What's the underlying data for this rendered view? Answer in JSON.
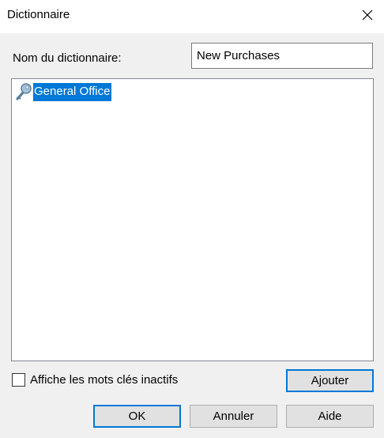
{
  "window": {
    "title": "Dictionnaire"
  },
  "form": {
    "name_label": "Nom du dictionnaire:",
    "name_value": "New Purchases"
  },
  "tree": {
    "items": [
      {
        "label": "General Office",
        "icon": "key-icon",
        "selected": true
      }
    ]
  },
  "options": {
    "show_inactive_label": "Affiche les mots clés inactifs",
    "show_inactive_checked": false
  },
  "buttons": {
    "add": "Ajouter",
    "ok": "OK",
    "cancel": "Annuler",
    "help": "Aide"
  },
  "colors": {
    "selection": "#0078d7",
    "default_button_border": "#0078d7"
  }
}
